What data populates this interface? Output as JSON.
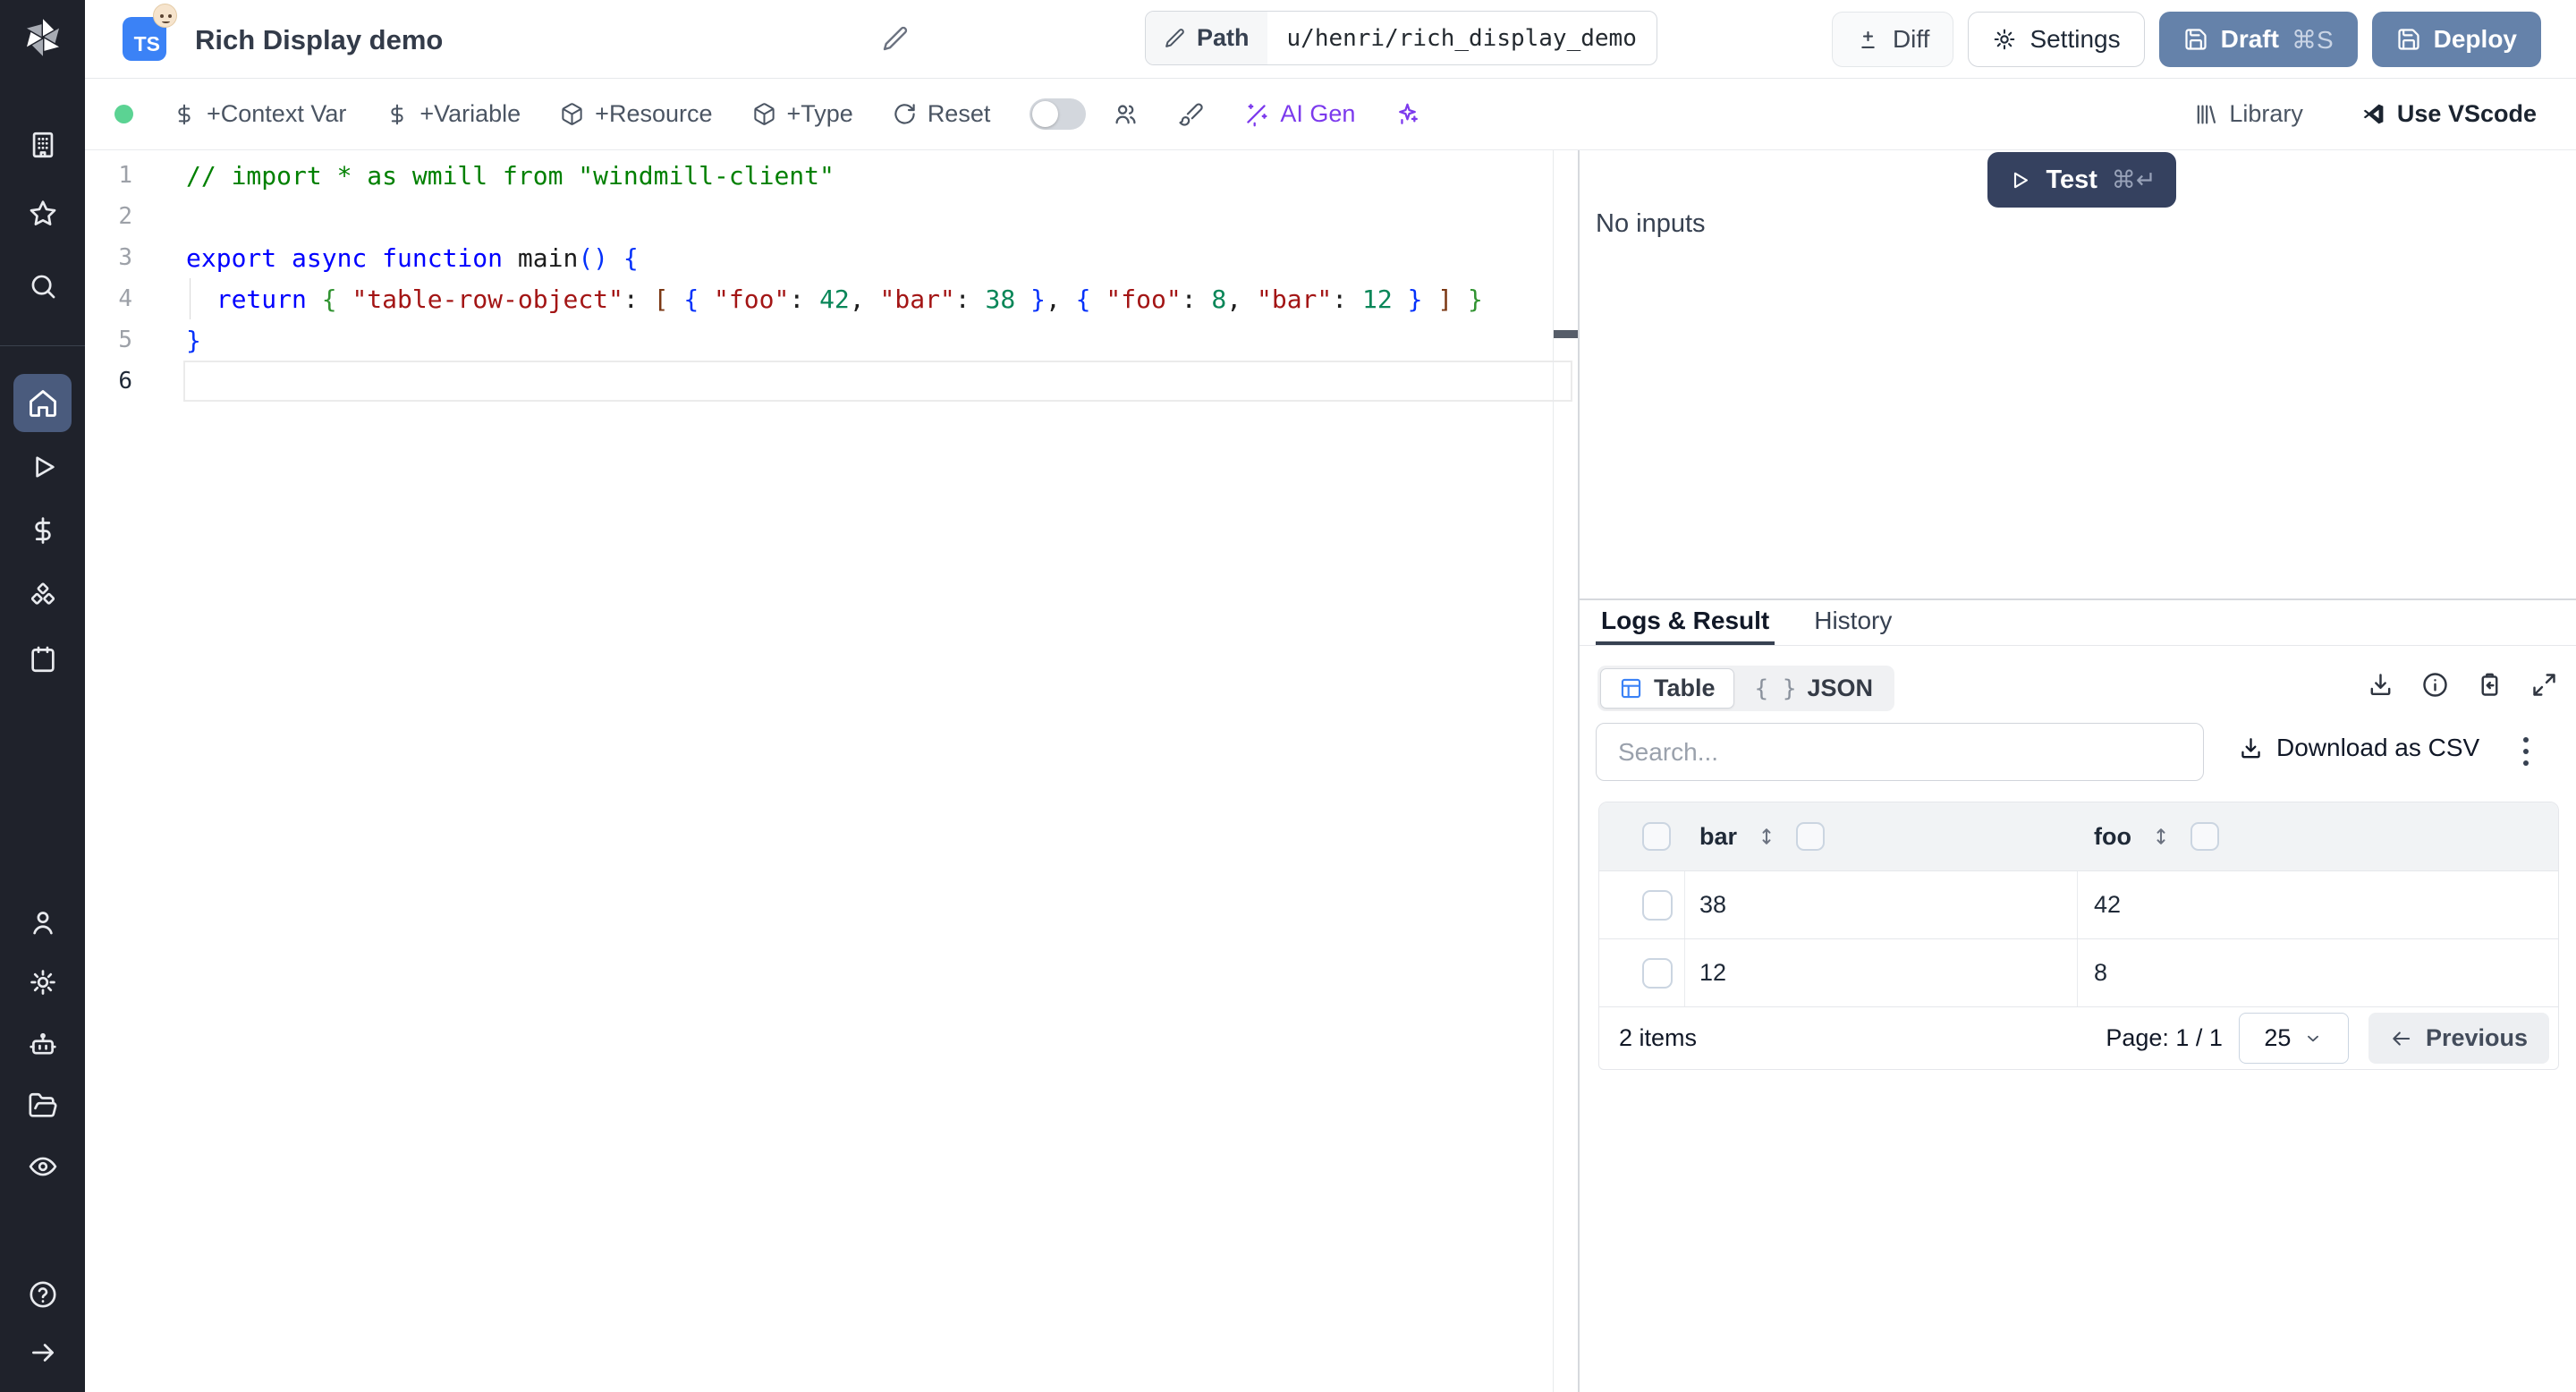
{
  "topbar": {
    "language_badge": "TS",
    "title": "Rich Display demo",
    "path_label": "Path",
    "path_value": "u/henri/rich_display_demo",
    "diff_label": "Diff",
    "settings_label": "Settings",
    "draft_label": "Draft",
    "draft_shortcut": "⌘S",
    "deploy_label": "Deploy"
  },
  "toolbar": {
    "context_var": "+Context Var",
    "variable": "+Variable",
    "resource": "+Resource",
    "type": "+Type",
    "reset": "Reset",
    "ai_gen": "AI Gen",
    "library": "Library",
    "use_vscode": "Use VScode"
  },
  "sidebar": {
    "icons_top": [
      "building-icon",
      "star-icon",
      "search-icon"
    ],
    "icons_main": [
      "home-icon",
      "play-icon",
      "dollar-icon",
      "boxes-icon",
      "calendar-icon"
    ],
    "icons_bottom": [
      "user-icon",
      "gear-icon",
      "bot-icon",
      "folder-icon",
      "eye-icon"
    ],
    "icons_footer": [
      "help-icon",
      "arrow-right-icon"
    ],
    "active_item": "home"
  },
  "editor": {
    "lines": [
      {
        "n": "1",
        "tokens": [
          [
            "// import * as wmill from \"windmill-client\"",
            "cmt"
          ]
        ]
      },
      {
        "n": "2",
        "tokens": []
      },
      {
        "n": "3",
        "tokens": [
          [
            "export async function ",
            "kw"
          ],
          [
            "main",
            "fn"
          ],
          [
            "()",
            "b1"
          ],
          [
            " ",
            "pl"
          ],
          [
            "{",
            "b1"
          ]
        ]
      },
      {
        "n": "4",
        "tokens": [
          [
            "  ",
            "pl"
          ],
          [
            "return ",
            "kw"
          ],
          [
            "{",
            "b2"
          ],
          [
            " ",
            "pl"
          ],
          [
            "\"table-row-object\"",
            "str"
          ],
          [
            ": ",
            "pl"
          ],
          [
            "[",
            "b3"
          ],
          [
            " ",
            "pl"
          ],
          [
            "{",
            "b1"
          ],
          [
            " ",
            "pl"
          ],
          [
            "\"foo\"",
            "str"
          ],
          [
            ": ",
            "pl"
          ],
          [
            "42",
            "num"
          ],
          [
            ", ",
            "pl"
          ],
          [
            "\"bar\"",
            "str"
          ],
          [
            ": ",
            "pl"
          ],
          [
            "38",
            "num"
          ],
          [
            " ",
            "pl"
          ],
          [
            "}",
            "b1"
          ],
          [
            ", ",
            "pl"
          ],
          [
            "{",
            "b1"
          ],
          [
            " ",
            "pl"
          ],
          [
            "\"foo\"",
            "str"
          ],
          [
            ": ",
            "pl"
          ],
          [
            "8",
            "num"
          ],
          [
            ", ",
            "pl"
          ],
          [
            "\"bar\"",
            "str"
          ],
          [
            ": ",
            "pl"
          ],
          [
            "12",
            "num"
          ],
          [
            " ",
            "pl"
          ],
          [
            "}",
            "b1"
          ],
          [
            " ",
            "pl"
          ],
          [
            "]",
            "b3"
          ],
          [
            " ",
            "pl"
          ],
          [
            "}",
            "b2"
          ]
        ]
      },
      {
        "n": "5",
        "tokens": [
          [
            "}",
            "b1"
          ]
        ]
      },
      {
        "n": "6",
        "tokens": [],
        "current": true
      }
    ]
  },
  "run_panel": {
    "test_label": "Test",
    "test_shortcut": "⌘↵",
    "no_inputs_label": "No inputs"
  },
  "result_panel": {
    "tabs": [
      {
        "label": "Logs & Result"
      },
      {
        "label": "History"
      }
    ],
    "views": [
      {
        "label": "Table"
      },
      {
        "label": "JSON"
      }
    ],
    "json_icon": "{ }",
    "search_placeholder": "Search...",
    "download_csv_label": "Download as CSV",
    "table": {
      "columns": [
        "bar",
        "foo"
      ],
      "rows": [
        [
          "38",
          "42"
        ],
        [
          "12",
          "8"
        ]
      ],
      "items_count": "2 items",
      "page_info": "Page: 1 / 1",
      "page_size": "25",
      "previous_label": "Previous"
    }
  },
  "colors": {
    "sidebar_bg": "#1f222b",
    "sidebar_active_bg": "#4a5b7d",
    "slate_button": "#6582aa",
    "test_button": "#35415f",
    "ai_purple": "#7c3aed",
    "table_icon_blue": "#3b82f6",
    "status_green": "#5bd393",
    "tab_underline": "#374151",
    "ts_badge_blue": "#3b82f6"
  }
}
